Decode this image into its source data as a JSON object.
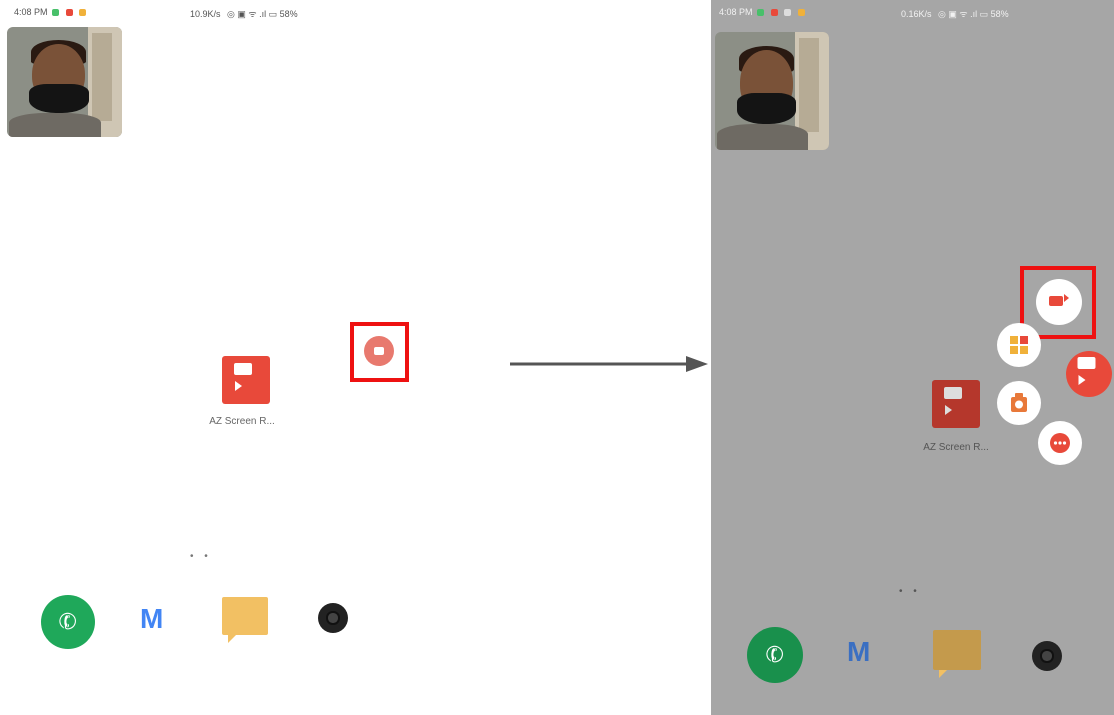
{
  "left_screen": {
    "status": {
      "time": "4:08 PM",
      "net_speed": "10.9K/s",
      "battery": "58%"
    },
    "app": {
      "label": "AZ Screen R..."
    },
    "dock": [
      "phone",
      "gmail",
      "messages",
      "camera"
    ]
  },
  "right_screen": {
    "status": {
      "time": "4:08 PM",
      "net_speed": "0.16K/s",
      "battery": "58%"
    },
    "app": {
      "label": "AZ Screen R..."
    },
    "floating_menu": [
      "record",
      "tools",
      "az-bubble",
      "screenshot",
      "more"
    ],
    "dock": [
      "phone",
      "gmail",
      "messages",
      "camera"
    ]
  },
  "colors": {
    "accent": "#e8493a",
    "highlight": "#ee1111",
    "phone_green": "#1fa85a"
  }
}
